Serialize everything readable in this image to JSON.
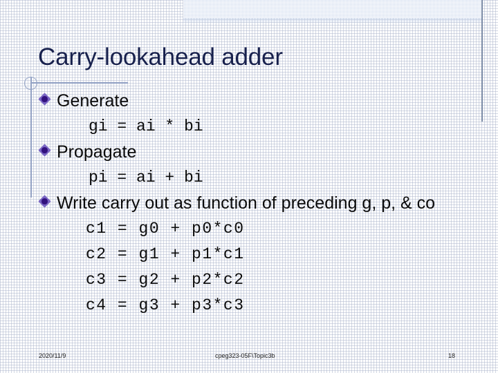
{
  "slide": {
    "title": "Carry-lookahead adder",
    "accent_color": "#18214d",
    "bullet_color": "#32117e",
    "band_color": "#c5d3ea",
    "rule_color": "#93a2c4"
  },
  "content": {
    "lines": [
      {
        "kind": "bullet",
        "text": "Generate"
      },
      {
        "kind": "code",
        "text": "gi = ai * bi"
      },
      {
        "kind": "bullet",
        "text": "Propagate"
      },
      {
        "kind": "code",
        "text": "pi = ai + bi"
      },
      {
        "kind": "bullet",
        "text": "Write carry out as function of preceding g, p, & co"
      },
      {
        "kind": "eq",
        "text": "c1 = g0 + p0*c0"
      },
      {
        "kind": "eq",
        "text": "c2 = g1 + p1*c1"
      },
      {
        "kind": "eq",
        "text": "c3 = g2 + p2*c2"
      },
      {
        "kind": "eq",
        "text": "c4 = g3 + p3*c3"
      }
    ]
  },
  "footer": {
    "date": "2020/11/9",
    "path": "cpeg323-05F\\Topic3b",
    "page_number": "18"
  },
  "icons": {
    "bullet": "diamond-bullet-icon"
  }
}
